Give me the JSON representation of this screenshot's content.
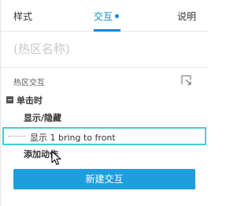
{
  "tabs": {
    "style": "样式",
    "interactions": "交互",
    "notes": "说明",
    "active": "interactions"
  },
  "hotspot": {
    "name_placeholder": "(热区名称)"
  },
  "section": {
    "label": "热区交互",
    "expand_icon": "expand-icon"
  },
  "tree": {
    "event": "单击时",
    "case": "显示/隐藏",
    "action": "显示 1  bring to front",
    "add_action": "添加动作"
  },
  "button": {
    "new_interaction": "新建交互"
  },
  "colors": {
    "accent": "#0a8ad1",
    "button": "#1f9ede",
    "selection_border": "#3fd1d0",
    "placeholder": "#c8c8c8"
  }
}
